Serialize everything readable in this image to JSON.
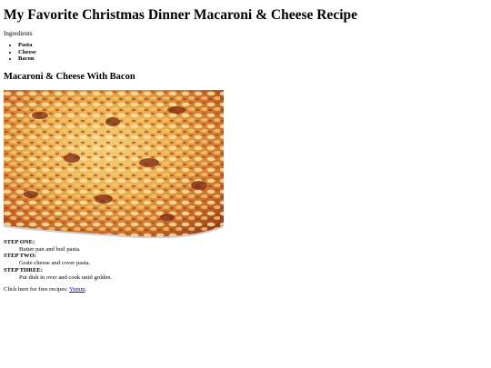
{
  "title": "My Favorite Christmas Dinner Macaroni & Cheese Recipe",
  "ingredients": {
    "label": "Ingredients",
    "items": [
      "Pasta",
      "Cheese",
      "Bacon"
    ]
  },
  "recipe_heading": "Macaroni & Cheese With Bacon",
  "steps": [
    {
      "label": "STEP ONE:",
      "text": "Butter pan and boil pasta."
    },
    {
      "label": "STEP TWO:",
      "text": "Grate cheese and cover pasta."
    },
    {
      "label": "STEP THREE:",
      "text": "Put dish in over and cook until golden."
    }
  ],
  "cta": {
    "prefix": "Click here for free recipes: ",
    "link_text": "Yumm",
    "suffix": "."
  }
}
